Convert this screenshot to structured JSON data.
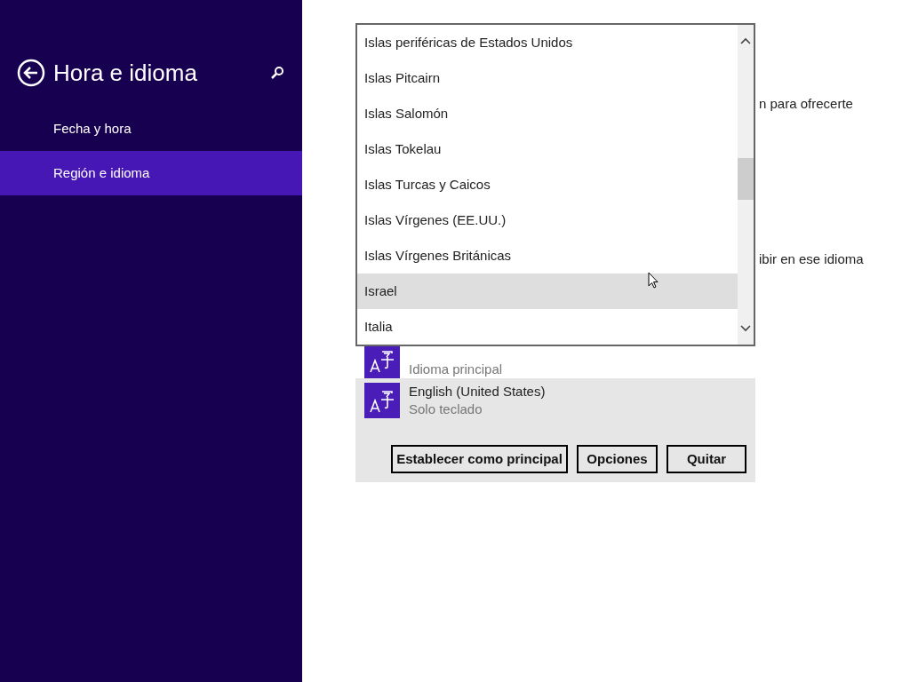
{
  "sidebar": {
    "title": "Hora e idioma",
    "items": [
      {
        "label": "Fecha y hora",
        "selected": false
      },
      {
        "label": "Región e idioma",
        "selected": true
      }
    ]
  },
  "background_texts": [
    "n para ofrecerte",
    "ibir en ese idioma"
  ],
  "languages": [
    {
      "status": "Idioma principal",
      "selected": false
    },
    {
      "name": "English (United States)",
      "status": "Solo teclado",
      "selected": true
    }
  ],
  "language_buttons": [
    "Establecer como principal",
    "Opciones",
    "Quitar"
  ],
  "dropdown": {
    "items": [
      {
        "label": "Islas periféricas de Estados Unidos",
        "highlighted": false
      },
      {
        "label": "Islas Pitcairn",
        "highlighted": false
      },
      {
        "label": "Islas Salomón",
        "highlighted": false
      },
      {
        "label": "Islas Tokelau",
        "highlighted": false
      },
      {
        "label": "Islas Turcas y Caicos",
        "highlighted": false
      },
      {
        "label": "Islas Vírgenes (EE.UU.)",
        "highlighted": false
      },
      {
        "label": "Islas Vírgenes Británicas",
        "highlighted": false
      },
      {
        "label": "Israel",
        "highlighted": true
      },
      {
        "label": "Italia",
        "highlighted": false
      }
    ]
  }
}
